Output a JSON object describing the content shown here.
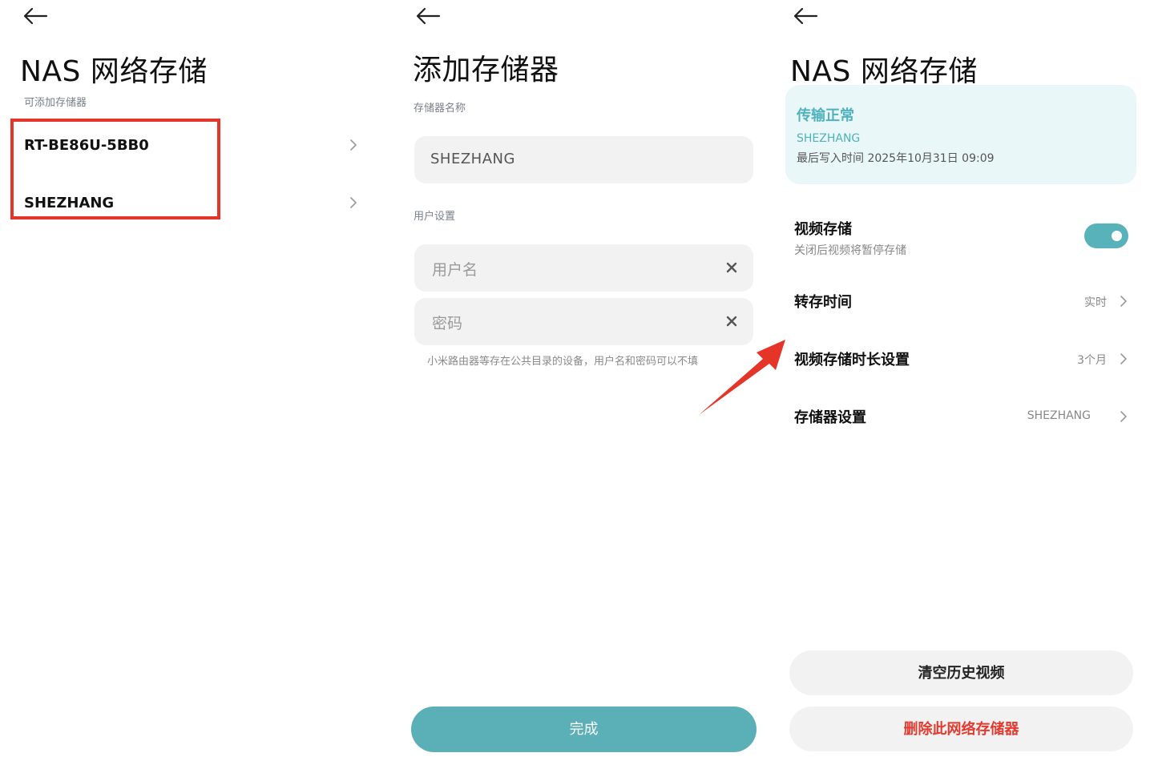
{
  "panel1": {
    "title": "NAS 网络存储",
    "section_label": "可添加存储器",
    "storage_items": [
      {
        "label": "RT-BE86U-5BB0"
      },
      {
        "label": "SHEZHANG"
      }
    ],
    "highlight_color": "#e53529"
  },
  "panel2": {
    "title": "添加存储器",
    "name_section_label": "存储器名称",
    "name_value": "SHEZHANG",
    "user_section_label": "用户设置",
    "username_placeholder": "用户名",
    "password_placeholder": "密码",
    "hint": "小米路由器等存在公共目录的设备，用户名和密码可以不填",
    "done_label": "完成",
    "accent_color": "#5ab0b6"
  },
  "panel3": {
    "title": "NAS 网络存储",
    "status": {
      "title": "传输正常",
      "device": "SHEZHANG",
      "last_write": "最后写入时间 2025年10月31日 09:09"
    },
    "settings": {
      "video_storage": {
        "label": "视频存储",
        "sub": "关闭后视频将暂停存储",
        "enabled": true
      },
      "transfer_time": {
        "label": "转存时间",
        "value": "实时"
      },
      "retention": {
        "label": "视频存储时长设置",
        "value": "3个月"
      },
      "storage_settings": {
        "label": "存储器设置",
        "value": "SHEZHANG"
      }
    },
    "clear_label": "清空历史视频",
    "delete_label": "删除此网络存储器",
    "delete_color": "#e53a30",
    "annotation_arrow_color": "#e53529"
  },
  "icons": [
    "back-arrow-icon",
    "chevron-right-icon",
    "clear-icon",
    "toggle-switch"
  ]
}
